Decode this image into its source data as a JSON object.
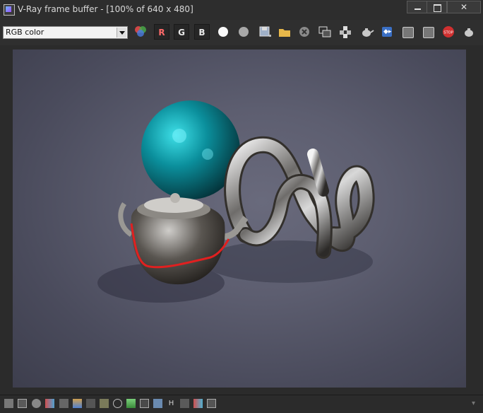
{
  "window": {
    "title": "V-Ray frame buffer - [100% of 640 x 480]",
    "min_label": "",
    "max_label": "",
    "close_label": "✕"
  },
  "toolbar": {
    "channel_value": "RGB color",
    "red_label": "R",
    "green_label": "G",
    "blue_label": "B",
    "icons": [
      "color-wheel-icon",
      "white-circle-icon",
      "gray-circle-icon",
      "save-image-icon",
      "open-image-icon",
      "clear-image-icon",
      "copy-to-max-icon",
      "track-mouse-icon",
      "render-teapot-icon",
      "compare-icon",
      "region-render-icon",
      "link-render-icon",
      "stop-render-icon",
      "render-last-icon"
    ],
    "stop_label": "STOP"
  },
  "statusbar": {
    "h_label": "H",
    "icons": [
      "stats-icon",
      "history-icon",
      "info-icon",
      "levels-icon",
      "hsl-icon",
      "color-balance-icon",
      "curves-icon",
      "exposure-icon",
      "lens-icon",
      "lut-icon",
      "ocio-icon",
      "white-balance-icon",
      "h-icon",
      "compare-ab-icon",
      "stamp-icon",
      "pixel-info-icon",
      "expand-icon"
    ]
  }
}
